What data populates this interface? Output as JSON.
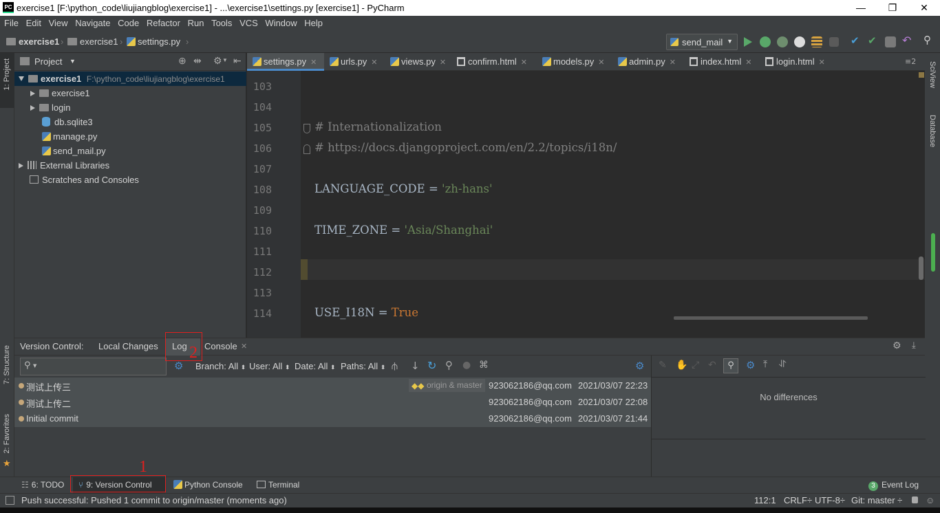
{
  "window": {
    "app_badge": "PC",
    "title": "exercise1 [F:\\python_code\\liujiangblog\\exercise1] - ...\\exercise1\\settings.py [exercise1] - PyCharm",
    "min": "—",
    "restore": "❐",
    "close": "✕"
  },
  "menu": [
    "File",
    "Edit",
    "View",
    "Navigate",
    "Code",
    "Refactor",
    "Run",
    "Tools",
    "VCS",
    "Window",
    "Help"
  ],
  "breadcrumb": [
    "exercise1",
    "exercise1",
    "settings.py"
  ],
  "run_config": "send_mail",
  "project_panel": {
    "title": "Project",
    "tree": [
      {
        "label": "exercise1",
        "path": "F:\\python_code\\liujiangblog\\exercise1"
      },
      {
        "label": "exercise1"
      },
      {
        "label": "login"
      },
      {
        "label": "db.sqlite3"
      },
      {
        "label": "manage.py"
      },
      {
        "label": "send_mail.py"
      },
      {
        "label": "External Libraries"
      },
      {
        "label": "Scratches and Consoles"
      }
    ]
  },
  "side_tabs": {
    "project": "1: Project",
    "structure": "7: Structure",
    "favorites": "2: Favorites",
    "sciview": "SciView",
    "database": "Database"
  },
  "editor_tabs": [
    "settings.py",
    "urls.py",
    "views.py",
    "confirm.html",
    "models.py",
    "admin.py",
    "index.html",
    "login.html"
  ],
  "editor_tab_overflow": "≡2",
  "code": {
    "line_numbers": [
      "103",
      "104",
      "105",
      "106",
      "107",
      "108",
      "109",
      "110",
      "111",
      "112",
      "113",
      "114"
    ],
    "comment1": "# Internationalization",
    "comment2": "# https://docs.djangoproject.com/en/2.2/topics/i18n/",
    "lang_name": "LANGUAGE_CODE = ",
    "lang_val": "'zh-hans'",
    "tz_name": "TIME_ZONE = ",
    "tz_val": "'Asia/Shanghai'",
    "i18n_name": "USE_I18N = ",
    "i18n_val": "True"
  },
  "version_control": {
    "label": "Version Control:",
    "tabs": [
      "Local Changes",
      "Log",
      "Console"
    ],
    "filters": [
      "Branch: All",
      "User: All",
      "Date: All",
      "Paths: All"
    ],
    "commits": [
      {
        "message": "测试上传三",
        "ref": "origin & master",
        "author": "923062186@qq.com",
        "date": "2021/03/07 22:23"
      },
      {
        "message": "测试上传二",
        "author": "923062186@qq.com",
        "date": "2021/03/07 22:08"
      },
      {
        "message": "Initial commit",
        "author": "923062186@qq.com",
        "date": "2021/03/07 21:44"
      }
    ],
    "diff_text": "No differences"
  },
  "bottom_tabs": {
    "todo": "6: TODO",
    "vc": "9: Version Control",
    "python_console": "Python Console",
    "terminal": "Terminal",
    "event_log": "Event Log",
    "event_count": "3"
  },
  "status": {
    "message": "Push successful: Pushed 1 commit to origin/master (moments ago)",
    "position": "112:1",
    "line_sep": "CRLF÷",
    "encoding": "UTF-8÷",
    "git": "Git: master ÷"
  },
  "annotations": {
    "mark1": "1",
    "mark2": "2"
  }
}
